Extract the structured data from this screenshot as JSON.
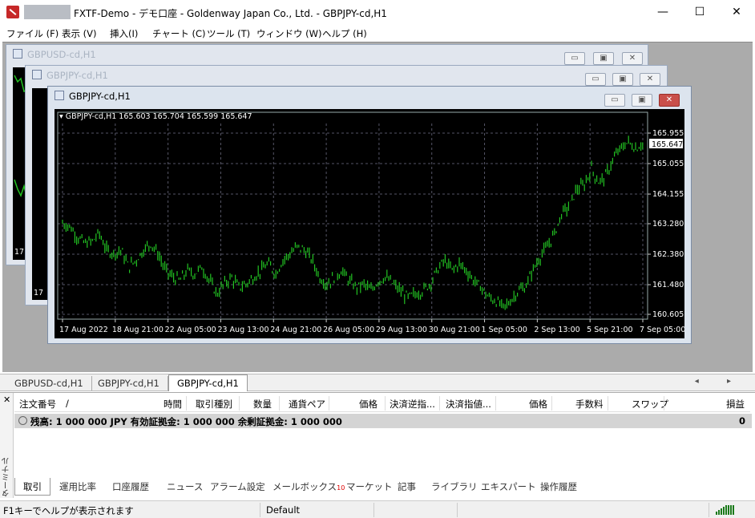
{
  "app": {
    "title": "FXTF-Demo - デモ口座 - Goldenway Japan Co., Ltd. - GBPJPY-cd,H1",
    "controls": {
      "minimize": "—",
      "maximize": "☐",
      "close": "✕"
    }
  },
  "menu": [
    "ファイル (F)",
    "表示 (V)",
    "挿入(I)",
    "チャート (C)",
    "ツール (T)",
    "ウィンドウ (W)",
    "ヘルプ (H)"
  ],
  "windows": [
    {
      "title": "GBPUSD-cd,H1",
      "corner_label": "17"
    },
    {
      "title": "GBPJPY-cd,H1",
      "corner_label": "17"
    },
    {
      "title": "GBPJPY-cd,H1"
    }
  ],
  "window_buttons": {
    "minimize": "▭",
    "restore": "▣",
    "close": "✕"
  },
  "chart_data": {
    "type": "bar",
    "header": "GBPJPY-cd,H1  165.603 165.704 165.599 165.647",
    "series": [
      {
        "name": "GBPJPY-cd,H1",
        "color": "#22c222"
      }
    ],
    "x_labels": [
      "17 Aug 2022",
      "18 Aug 21:00",
      "22 Aug 05:00",
      "23 Aug 13:00",
      "24 Aug 21:00",
      "26 Aug 05:00",
      "29 Aug 13:00",
      "30 Aug 21:00",
      "1 Sep 05:00",
      "2 Sep 13:00",
      "5 Sep 21:00",
      "7 Sep 05:00"
    ],
    "y_labels": [
      "165.955",
      "165.055",
      "164.155",
      "163.280",
      "162.380",
      "161.480",
      "160.605"
    ],
    "ylim": [
      160.605,
      165.955
    ],
    "current_price": "165.647",
    "close_path": [
      [
        0,
        163.3
      ],
      [
        3,
        163.2
      ],
      [
        6,
        162.9
      ],
      [
        9,
        162.7
      ],
      [
        12,
        162.75
      ],
      [
        15,
        163.0
      ],
      [
        18,
        162.5
      ],
      [
        21,
        162.4
      ],
      [
        24,
        162.5
      ],
      [
        27,
        162.0
      ],
      [
        30,
        162.2
      ],
      [
        33,
        162.5
      ],
      [
        36,
        162.7
      ],
      [
        39,
        162.4
      ],
      [
        42,
        161.9
      ],
      [
        45,
        161.7
      ],
      [
        48,
        161.6
      ],
      [
        51,
        161.9
      ],
      [
        54,
        161.8
      ],
      [
        57,
        162.0
      ],
      [
        60,
        161.6
      ],
      [
        63,
        161.2
      ],
      [
        66,
        161.5
      ],
      [
        69,
        161.7
      ],
      [
        72,
        161.4
      ],
      [
        75,
        161.5
      ],
      [
        78,
        161.7
      ],
      [
        81,
        161.9
      ],
      [
        84,
        162.1
      ],
      [
        87,
        161.8
      ],
      [
        90,
        162.2
      ],
      [
        93,
        162.4
      ],
      [
        96,
        162.6
      ],
      [
        99,
        162.5
      ],
      [
        102,
        162.2
      ],
      [
        105,
        161.7
      ],
      [
        108,
        161.5
      ],
      [
        111,
        161.7
      ],
      [
        114,
        161.9
      ],
      [
        117,
        161.6
      ],
      [
        120,
        161.4
      ],
      [
        123,
        161.5
      ],
      [
        126,
        161.3
      ],
      [
        129,
        161.6
      ],
      [
        132,
        161.7
      ],
      [
        135,
        161.5
      ],
      [
        138,
        161.3
      ],
      [
        141,
        161.1
      ],
      [
        144,
        161.2
      ],
      [
        147,
        161.3
      ],
      [
        150,
        161.5
      ],
      [
        153,
        161.9
      ],
      [
        156,
        162.2
      ],
      [
        159,
        161.9
      ],
      [
        162,
        162.1
      ],
      [
        165,
        161.9
      ],
      [
        168,
        161.6
      ],
      [
        171,
        161.4
      ],
      [
        174,
        161.1
      ],
      [
        177,
        161.0
      ],
      [
        180,
        160.8
      ],
      [
        183,
        161.0
      ],
      [
        186,
        161.3
      ],
      [
        189,
        161.4
      ],
      [
        192,
        161.9
      ],
      [
        195,
        162.3
      ],
      [
        198,
        162.6
      ],
      [
        201,
        163.0
      ],
      [
        204,
        163.6
      ],
      [
        207,
        163.8
      ],
      [
        210,
        164.3
      ],
      [
        213,
        164.4
      ],
      [
        216,
        164.9
      ],
      [
        219,
        164.5
      ],
      [
        222,
        164.7
      ],
      [
        225,
        165.2
      ],
      [
        228,
        165.5
      ],
      [
        231,
        165.7
      ],
      [
        234,
        165.5
      ],
      [
        237,
        165.647
      ]
    ]
  },
  "chart_tabs": [
    "GBPUSD-cd,H1",
    "GBPJPY-cd,H1",
    "GBPJPY-cd,H1"
  ],
  "tab_arrows": "◂ ▸",
  "terminal": {
    "side_label": "ターミナル",
    "close": "✕",
    "columns": [
      "注文番号",
      "/",
      "時間",
      "取引種別",
      "数量",
      "通貨ペア",
      "価格",
      "決済逆指...",
      "決済指値...",
      "価格",
      "手数料",
      "スワップ",
      "損益"
    ],
    "balance": "残高: 1 000 000 JPY  有効証拠金: 1 000 000  余剰証拠金: 1 000 000",
    "profit": "0",
    "tabs": [
      "取引",
      "運用比率",
      "口座履歴",
      "ニュース",
      "アラーム設定",
      "メールボックス",
      "マーケット",
      "記事",
      "ライブラリ",
      "エキスパート",
      "操作履歴"
    ],
    "mailbox_badge": "10"
  },
  "status": {
    "help": "F1キーでヘルプが表示されます",
    "profile": "Default"
  }
}
